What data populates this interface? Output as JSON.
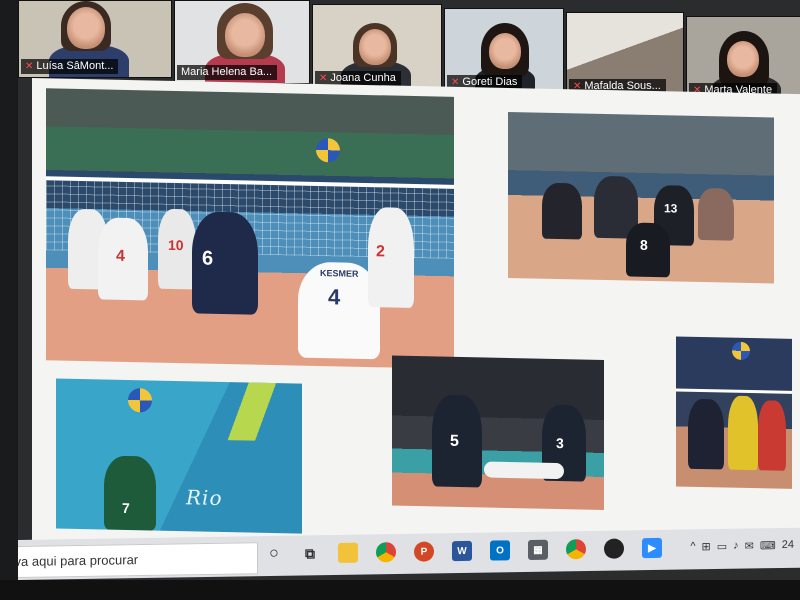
{
  "participants": [
    {
      "name": "Luísa SâMont...",
      "bg": "#c9c3b6",
      "shirt": "#2d3e6b"
    },
    {
      "name": "Maria Helena Ba...",
      "bg": "#e0e2e4",
      "shirt": "#b53b4e"
    },
    {
      "name": "Joana Cunha",
      "bg": "#d8d2c6",
      "shirt": "#2c2f35"
    },
    {
      "name": "Goreti Dias",
      "bg": "#cdd5da",
      "shirt": "#1f2228"
    },
    {
      "name": "Mafalda Sous...",
      "bg": "#b8b2aa",
      "shirt": "#3a3a3a"
    },
    {
      "name": "Marta Valente",
      "bg": "#a9a49c",
      "shirt": "#2b2b2b"
    }
  ],
  "slide": {
    "jerseys": {
      "player_6": "6",
      "player_4": "4",
      "player_4_name": "KESMER",
      "player_2": "2",
      "player_4b": "4",
      "player_7": "7",
      "player_5": "5",
      "player_8": "8",
      "player_13": "13",
      "player_3": "3",
      "player_10": "10"
    },
    "rio_logo": "Rio"
  },
  "taskbar": {
    "search_placeholder": "reva aqui para procurar",
    "icons": [
      {
        "name": "search-circle-icon",
        "glyph": "○"
      },
      {
        "name": "task-view-icon",
        "glyph": "⧉"
      },
      {
        "name": "file-explorer-icon",
        "glyph": "▆"
      },
      {
        "name": "chrome-icon",
        "glyph": "◉"
      },
      {
        "name": "powerpoint-icon",
        "glyph": "P"
      },
      {
        "name": "word-icon",
        "glyph": "W"
      },
      {
        "name": "outlook-icon",
        "glyph": "O"
      },
      {
        "name": "calculator-icon",
        "glyph": "▦"
      },
      {
        "name": "chrome-icon-2",
        "glyph": "◉"
      },
      {
        "name": "obs-icon",
        "glyph": "●"
      },
      {
        "name": "zoom-icon",
        "glyph": "▶"
      }
    ],
    "tray": [
      "^",
      "⊞",
      "▭",
      "♪",
      "✉",
      "⌨"
    ],
    "time": "24"
  },
  "colors": {
    "taskbar_bg": "#dfe1e4",
    "slide_bg": "#f4f4f3",
    "name_tag_bg": "#000000",
    "mic_muted": "#ff4b4b"
  }
}
